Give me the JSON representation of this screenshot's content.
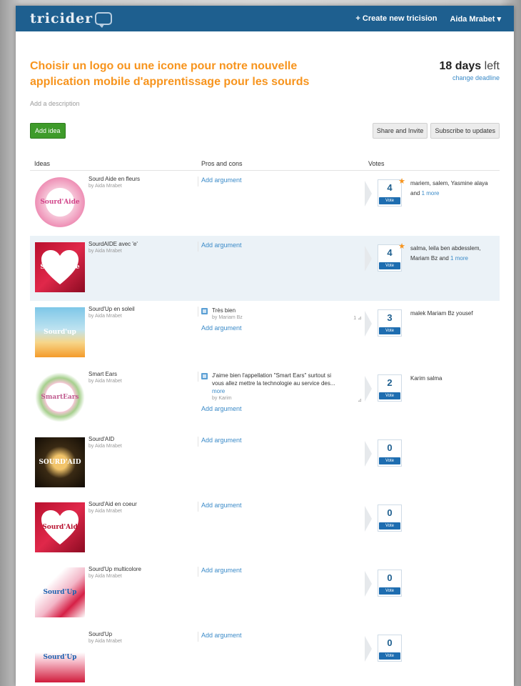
{
  "header": {
    "logo": "tricider",
    "create_link": "+ Create new tricision",
    "user_menu": "Aida Mrabet"
  },
  "tricision": {
    "title": "Choisir un logo ou une icone pour notre nouvelle application mobile d'apprentissage pour les sourds",
    "days_number": "18 days",
    "days_suffix": "left",
    "change_deadline": "change deadline",
    "add_description": "Add a description"
  },
  "buttons": {
    "add_idea": "Add idea",
    "share_invite": "Share and Invite",
    "subscribe": "Subscribe to updates"
  },
  "columns": {
    "ideas": "Ideas",
    "pros_cons": "Pros and cons",
    "votes": "Votes"
  },
  "add_argument_label": "Add argument",
  "vote_button_label": "Vote",
  "ideas": [
    {
      "name": "Sourd Aide en fleurs",
      "by": "by Aida Mrabet",
      "thumb_text": "Sourd'Aide",
      "votes": "4",
      "star": true,
      "voters_text": "mariem, salem, Yasmine alaya and",
      "voters_more": "1 more",
      "arguments": []
    },
    {
      "name": "SourdAIDE avec 'e'",
      "by": "by Aida Mrabet",
      "thumb_text": "Sourd'Aide",
      "votes": "4",
      "star": true,
      "voters_text": "salma, leila ben abdesslem, Mariam Bz and",
      "voters_more": "1 more",
      "arguments": []
    },
    {
      "name": "Sourd'Up en soleil",
      "by": "by Aida Mrabet",
      "thumb_text": "Sourd'up",
      "votes": "3",
      "star": false,
      "voters_text": "malek Mariam Bz yousef",
      "voters_more": "",
      "arguments": [
        {
          "text": "Très bien",
          "more": "",
          "by": "by Mariam Bz",
          "count": "1"
        }
      ]
    },
    {
      "name": "Smart Ears",
      "by": "by Aida Mrabet",
      "thumb_text": "SmartEars",
      "votes": "2",
      "star": false,
      "voters_text": "Karim salma",
      "voters_more": "",
      "arguments": [
        {
          "text": "J'aime bien l'appellation \"Smart Ears\" surtout si vous allez mettre la technologie au service des...",
          "more": "more",
          "by": "by Karim",
          "count": ""
        }
      ]
    },
    {
      "name": "Sourd'AID",
      "by": "by Aida Mrabet",
      "thumb_text": "SOURD'AID",
      "votes": "0",
      "star": false,
      "voters_text": "",
      "voters_more": "",
      "arguments": []
    },
    {
      "name": "Sourd'Aid en coeur",
      "by": "by Aida Mrabet",
      "thumb_text": "Sourd'Aid",
      "votes": "0",
      "star": false,
      "voters_text": "",
      "voters_more": "",
      "arguments": []
    },
    {
      "name": "Sourd'Up multicolore",
      "by": "by Aida Mrabet",
      "thumb_text": "Sourd'Up",
      "votes": "0",
      "star": false,
      "voters_text": "",
      "voters_more": "",
      "arguments": []
    },
    {
      "name": "Sourd'Up",
      "by": "by Aida Mrabet",
      "thumb_text": "Sourd'Up",
      "votes": "0",
      "star": false,
      "voters_text": "",
      "voters_more": "",
      "arguments": []
    }
  ],
  "colors": {
    "brand_blue": "#1e5f8f",
    "title_orange": "#f7941d",
    "add_idea_green": "#3e9b2a",
    "link_blue": "#3a8ac8",
    "highlight_row": "#ebf2f7"
  }
}
